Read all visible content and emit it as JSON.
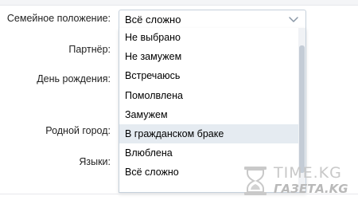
{
  "form": {
    "fields": [
      {
        "label": "Семейное положение:"
      },
      {
        "label": "Партнёр:"
      },
      {
        "label": "День рождения:"
      },
      {
        "label": "Родной город:"
      },
      {
        "label": "Языки:"
      }
    ]
  },
  "relationship_select": {
    "value": "Всё сложно",
    "options": [
      "Не выбрано",
      "Не замужем",
      "Встречаюсь",
      "Помолвлена",
      "Замужем",
      "В гражданском браке",
      "Влюблена",
      "Всё сложно"
    ],
    "highlighted_option": "В гражданском браке"
  },
  "watermark": {
    "line1": "TIME.KG",
    "line2": "ГАЗЕТА.KG"
  },
  "colors": {
    "border": "#c5d0db",
    "hover": "#e5ebf1",
    "scroll_thumb": "#c4ccd6"
  },
  "icons": {
    "select_chevron": "chevron-down-icon",
    "watermark_logo": "hourglass-icon"
  }
}
